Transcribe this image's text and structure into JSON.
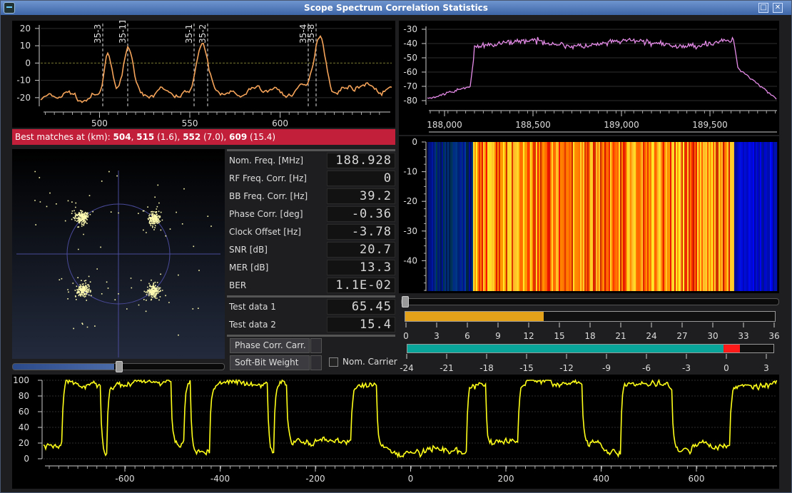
{
  "window": {
    "title": "Scope Spectrum Correlation Statistics"
  },
  "correlation": {
    "y_ticks": [
      "20",
      "10",
      "0",
      "-10",
      "-20"
    ],
    "x_ticks": [
      "500",
      "550",
      "600"
    ],
    "marker_labels": [
      "35-3",
      "35-11",
      "35-1",
      "35-2",
      "35-4",
      "35-8"
    ],
    "line_color": "#f5a45a",
    "banner": {
      "prefix": "Best matches at (km): ",
      "m1": "504",
      "sep1": ", ",
      "m2": "515",
      "d2": " (1.6), ",
      "m3": "552",
      "d3": " (7.0), ",
      "m4": "609",
      "d4": " (15.4)"
    }
  },
  "spectrum": {
    "y_ticks": [
      "-30",
      "-40",
      "-50",
      "-60",
      "-70",
      "-80"
    ],
    "x_ticks": [
      "188,000",
      "188,500",
      "189,000",
      "189,500"
    ],
    "line_color": "#e58be8"
  },
  "waterfall": {
    "y_ticks": [
      "0",
      "-10",
      "-20",
      "-30",
      "-40"
    ]
  },
  "constellation": {
    "point_color": "#fffbb0",
    "axis_color": "#4a4a9a"
  },
  "stats": {
    "rows": [
      {
        "label": "Nom. Freq. [MHz]",
        "value": "188.928"
      },
      {
        "label": "RF Freq. Corr. [Hz]",
        "value": "0"
      },
      {
        "label": "BB Freq. Corr. [Hz]",
        "value": "39.2"
      },
      {
        "label": "Phase Corr. [deg]",
        "value": "-0.36"
      },
      {
        "label": "Clock Offset [Hz]",
        "value": "-3.78"
      },
      {
        "label": "SNR [dB]",
        "value": "20.7"
      },
      {
        "label": "MER [dB]",
        "value": "13.3"
      },
      {
        "label": "BER",
        "value": "1.1E-02"
      }
    ],
    "tests": [
      {
        "label": "Test data 1",
        "value": "65.45"
      },
      {
        "label": "Test data 2",
        "value": "15.4"
      }
    ]
  },
  "controls": {
    "phase_corr_carr": "Phase Corr. Carr.",
    "soft_bit_weight": "Soft-Bit Weight",
    "nom_carrier": "Nom. Carrier"
  },
  "snr_meter": {
    "ticks": [
      "0",
      "3",
      "6",
      "9",
      "12",
      "15",
      "18",
      "21",
      "24",
      "27",
      "30",
      "33",
      "36"
    ],
    "level": 13.5,
    "color": "#e3a21a"
  },
  "level_meter": {
    "ticks": [
      "-24",
      "-21",
      "-18",
      "-15",
      "-12",
      "-9",
      "-6",
      "-3",
      "0",
      "3"
    ],
    "level": 0.2,
    "peak": 0.8,
    "color": "#0aa59a",
    "peak_color": "#ff1a1a"
  },
  "softbits": {
    "y_ticks": [
      "100",
      "80",
      "60",
      "40",
      "20",
      "0"
    ],
    "x_ticks": [
      "-600",
      "-400",
      "-200",
      "0",
      "200",
      "400",
      "600"
    ],
    "line_color": "#ffff1a"
  }
}
